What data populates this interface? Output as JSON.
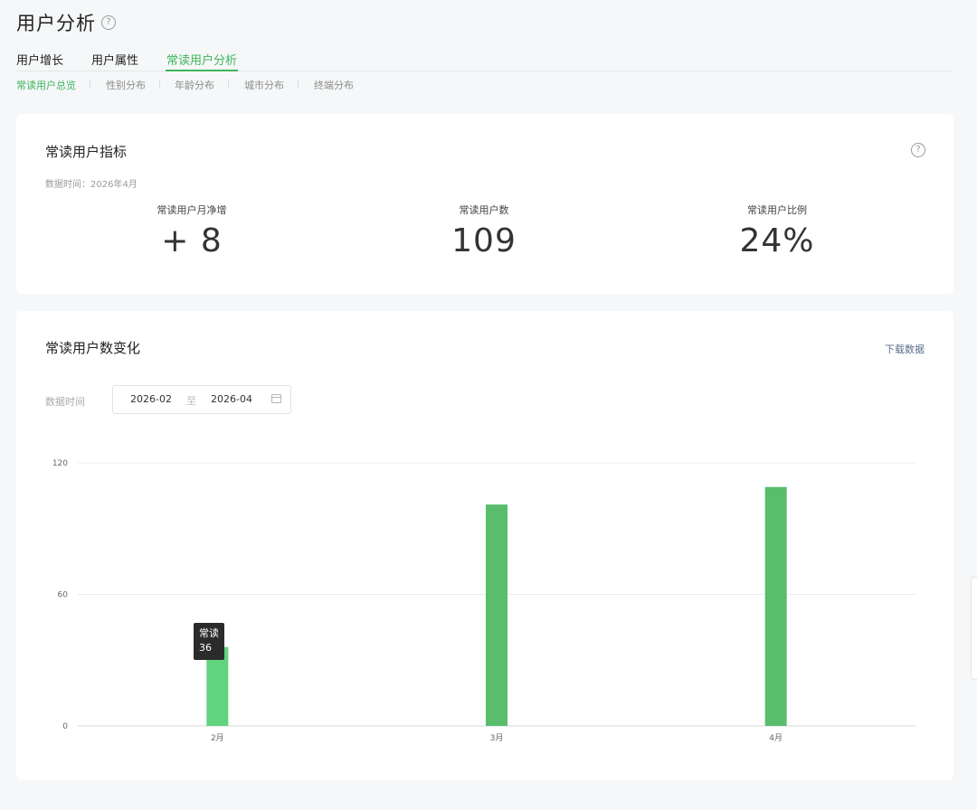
{
  "header": {
    "title": "用户分析",
    "help_icon": "question-circle-icon"
  },
  "main_tabs": [
    {
      "label": "用户增长",
      "active": false
    },
    {
      "label": "用户属性",
      "active": false
    },
    {
      "label": "常读用户分析",
      "active": true
    }
  ],
  "sub_tabs": [
    {
      "label": "常读用户总览",
      "active": true
    },
    {
      "label": "性别分布",
      "active": false
    },
    {
      "label": "年龄分布",
      "active": false
    },
    {
      "label": "城市分布",
      "active": false
    },
    {
      "label": "终端分布",
      "active": false
    }
  ],
  "metrics_card": {
    "title": "常读用户指标",
    "data_time": "数据时间：2026年4月",
    "metrics": [
      {
        "label": "常读用户月净增",
        "value": "+ 8"
      },
      {
        "label": "常读用户数",
        "value": "109"
      },
      {
        "label": "常读用户比例",
        "value": "24%"
      }
    ]
  },
  "trend_card": {
    "title": "常读用户数变化",
    "download_label": "下载数据",
    "range_label": "数据时间",
    "range_start": "2026-02",
    "range_separator": "至",
    "range_end": "2026-04",
    "tooltip_title": "常读",
    "tooltip_value": "36"
  },
  "colors": {
    "accent": "#3eb65b",
    "bar": "#59bd6c",
    "bar_hover": "#62d37f"
  },
  "chart_data": {
    "type": "bar",
    "categories": [
      "2月",
      "3月",
      "4月"
    ],
    "series": [
      {
        "name": "常读",
        "values": [
          36,
          101,
          109
        ]
      }
    ],
    "yticks": [
      0,
      60,
      120
    ],
    "ylim": [
      0,
      120
    ],
    "highlighted_index": 0,
    "grid": true
  }
}
